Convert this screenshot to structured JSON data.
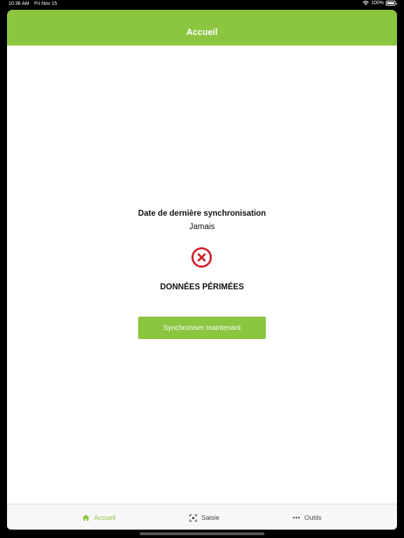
{
  "status_bar": {
    "time": "10:36 AM",
    "date": "Fri Nov 15",
    "battery": "100%"
  },
  "navbar": {
    "title": "Accueil"
  },
  "main": {
    "sync_label": "Date de dernière synchronisation",
    "sync_value": "Jamais",
    "status_icon": "error-x-circle-icon",
    "status_text": "DONNÉES PÉRIMÉES",
    "sync_button_label": "Synchroniser maintenant"
  },
  "tabs": [
    {
      "label": "Accueil",
      "icon": "home-icon",
      "active": true
    },
    {
      "label": "Saisie",
      "icon": "scan-icon",
      "active": false
    },
    {
      "label": "Outils",
      "icon": "more-dots-icon",
      "active": false
    }
  ],
  "colors": {
    "accent": "#8cc540",
    "error": "#d0202a"
  }
}
